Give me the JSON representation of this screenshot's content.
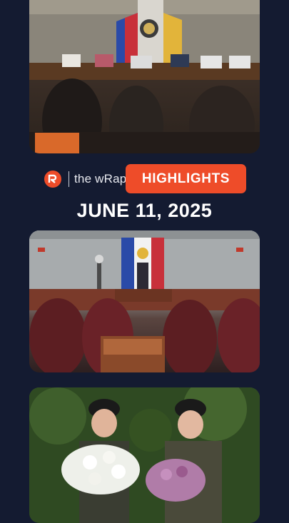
{
  "brand": {
    "logo_icon": "rappler-logo-icon",
    "name": "the wRap",
    "badge": "HIGHLIGHTS",
    "accent_color": "#ee4c29"
  },
  "date": "JUNE 11, 2025",
  "cards": [
    {
      "name": "news-photo-press-conference"
    },
    {
      "name": "news-photo-senate-session"
    },
    {
      "name": "news-photo-soldiers-with-flowers"
    }
  ],
  "colors": {
    "background": "#141b31"
  }
}
